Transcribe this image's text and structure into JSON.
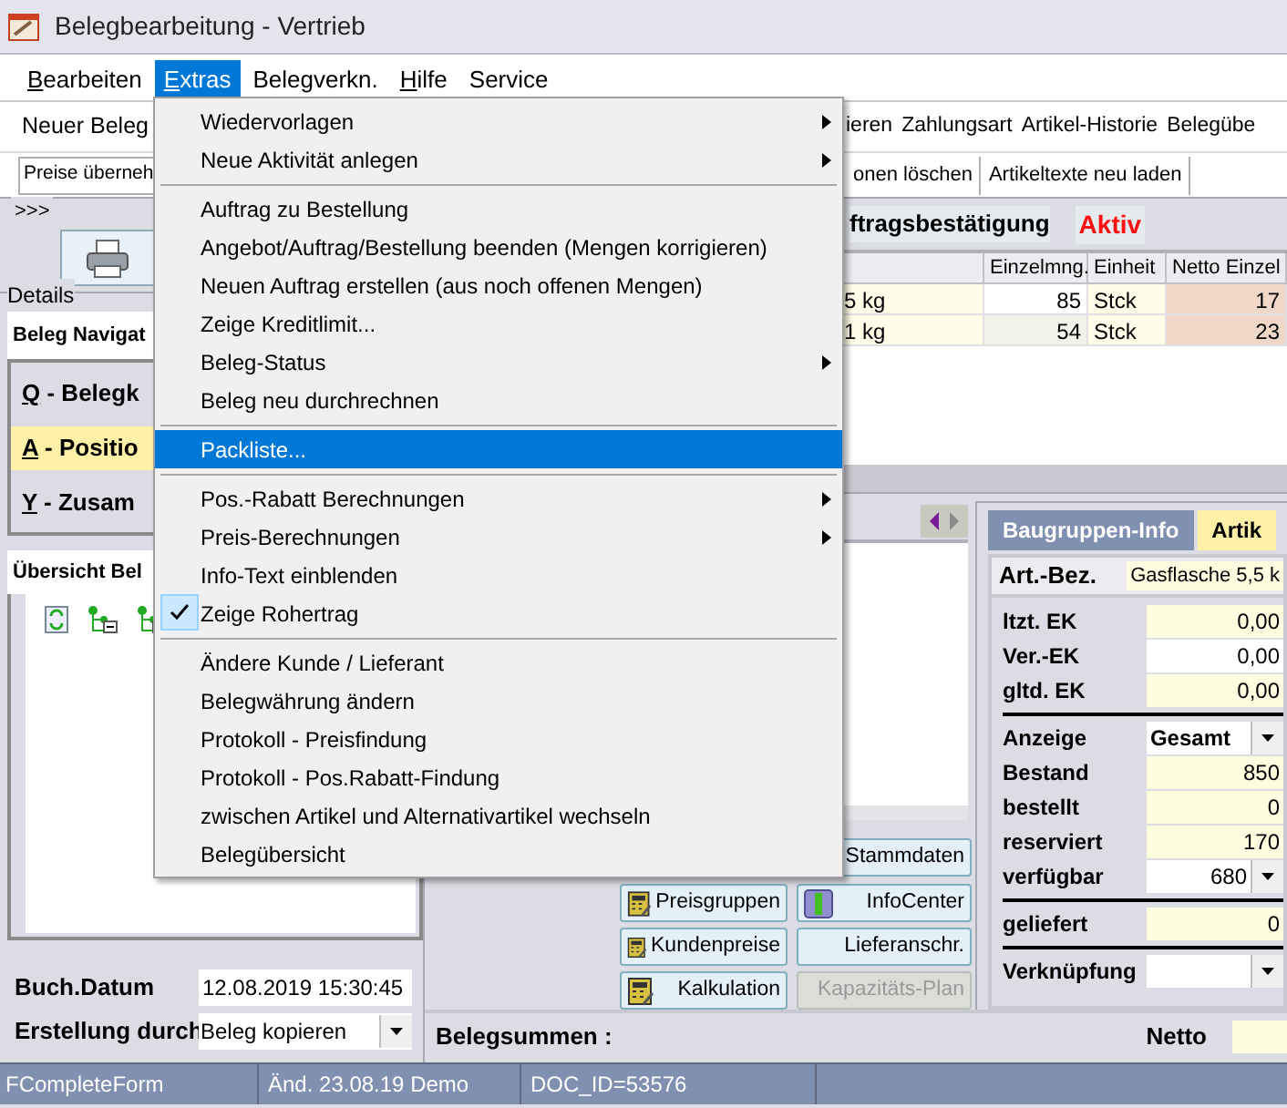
{
  "window": {
    "title": "Belegbearbeitung - Vertrieb"
  },
  "menu_bar": [
    {
      "label": "Bearbeiten",
      "selected": false
    },
    {
      "label": "Extras",
      "selected": true
    },
    {
      "label": "Belegverkn.",
      "selected": false
    },
    {
      "label": "Hilfe",
      "selected": false
    },
    {
      "label": "Service",
      "selected": false
    }
  ],
  "toolbar_1": {
    "left": "Neuer Beleg",
    "items": [
      "ieren",
      "Zahlungsart",
      "Artikel-Historie",
      "Belegübe"
    ]
  },
  "toolbar_2": {
    "left": "Preise überneh",
    "items": [
      "onen löschen",
      "Artikeltexte neu laden"
    ]
  },
  "expander": ">>>",
  "document": {
    "type": "ftragsbestätigung",
    "status": "Aktiv"
  },
  "table": {
    "columns": [
      "",
      "Einzelmng.",
      "Einheit",
      "Netto Einzel"
    ],
    "rows": [
      {
        "cells": [
          "5 kg",
          "85",
          "Stck",
          "17"
        ]
      },
      {
        "cells": [
          "1 kg",
          "54",
          "Stck",
          "23"
        ]
      }
    ]
  },
  "details": {
    "label": "Details",
    "navigator_tab": "Beleg Navigat",
    "nav_items": [
      {
        "label": "Q - Belegk",
        "selected": false
      },
      {
        "label": "A - Positio",
        "selected": true
      },
      {
        "label": "Y - Zusam",
        "selected": false
      }
    ],
    "overview_tab": "Übersicht Bel",
    "fields": [
      {
        "label": "Buch.Datum",
        "value": "12.08.2019 15:30:45",
        "kind": "text"
      },
      {
        "label": "Erstellung durch",
        "value": "Beleg kopieren",
        "kind": "dropdown"
      }
    ]
  },
  "buttons": [
    {
      "label": "Stammdaten",
      "disabled": false
    },
    {
      "label": "Preisgruppen",
      "disabled": false
    },
    {
      "label": "InfoCenter",
      "disabled": false
    },
    {
      "label": "Kundenpreise",
      "disabled": false
    },
    {
      "label": "Lieferanschr.",
      "disabled": false
    },
    {
      "label": "Kalkulation",
      "disabled": false
    },
    {
      "label": "Kapazitäts-Plan",
      "disabled": true
    }
  ],
  "info_tabs": [
    {
      "label": "Baugruppen-Info",
      "selected": false
    },
    {
      "label": "Artik",
      "selected": true
    }
  ],
  "article": {
    "label": "Art.-Bez.",
    "value": "Gasflasche 5,5 k"
  },
  "article_fields": [
    {
      "kind": "text",
      "label": "ltzt. EK",
      "value": "0,00",
      "highlighted": true
    },
    {
      "kind": "text",
      "label": "Ver.-EK",
      "value": "0,00",
      "highlighted": false
    },
    {
      "kind": "text",
      "label": "gltd. EK",
      "value": "0,00",
      "highlighted": true
    },
    {
      "kind": "separator"
    },
    {
      "kind": "dropdown",
      "label": "Anzeige",
      "value": "Gesamt",
      "highlighted": false
    },
    {
      "kind": "text",
      "label": "Bestand",
      "value": "850",
      "highlighted": true
    },
    {
      "kind": "text",
      "label": "bestellt",
      "value": "0",
      "highlighted": true
    },
    {
      "kind": "text",
      "label": "reserviert",
      "value": "170",
      "highlighted": true
    },
    {
      "kind": "dropdown",
      "label": "verfügbar",
      "value": "680",
      "highlighted": false
    },
    {
      "kind": "separator"
    },
    {
      "kind": "text",
      "label": "geliefert",
      "value": "0",
      "highlighted": true
    },
    {
      "kind": "separator"
    },
    {
      "kind": "dropdown",
      "label": "Verknüpfung",
      "highlighted": false
    }
  ],
  "summary": {
    "label": "Belegsummen :",
    "netto_label": "Netto"
  },
  "status_bar": [
    "FCompleteForm",
    "Änd. 23.08.19 Demo",
    "DOC_ID=53576"
  ],
  "menu": [
    {
      "kind": "item",
      "label": "Wiedervorlagen",
      "submenu": true,
      "selected": false,
      "checked": false
    },
    {
      "kind": "item",
      "label": "Neue Aktivität anlegen",
      "submenu": true,
      "selected": false,
      "checked": false
    },
    {
      "kind": "separator"
    },
    {
      "kind": "item",
      "label": "Auftrag zu Bestellung",
      "submenu": false,
      "selected": false,
      "checked": false
    },
    {
      "kind": "item",
      "label": "Angebot/Auftrag/Bestellung beenden (Mengen korrigieren)",
      "submenu": false,
      "selected": false,
      "checked": false
    },
    {
      "kind": "item",
      "label": "Neuen Auftrag erstellen (aus noch offenen Mengen)",
      "submenu": false,
      "selected": false,
      "checked": false
    },
    {
      "kind": "item",
      "label": "Zeige Kreditlimit...",
      "submenu": false,
      "selected": false,
      "checked": false
    },
    {
      "kind": "item",
      "label": "Beleg-Status",
      "submenu": true,
      "selected": false,
      "checked": false
    },
    {
      "kind": "item",
      "label": "Beleg neu durchrechnen",
      "submenu": false,
      "selected": false,
      "checked": false
    },
    {
      "kind": "separator"
    },
    {
      "kind": "item",
      "label": "Packliste...",
      "submenu": false,
      "selected": true,
      "checked": false
    },
    {
      "kind": "separator"
    },
    {
      "kind": "item",
      "label": "Pos.-Rabatt Berechnungen",
      "submenu": true,
      "selected": false,
      "checked": false
    },
    {
      "kind": "item",
      "label": "Preis-Berechnungen",
      "submenu": true,
      "selected": false,
      "checked": false
    },
    {
      "kind": "item",
      "label": "Info-Text einblenden",
      "submenu": false,
      "selected": false,
      "checked": false
    },
    {
      "kind": "item",
      "label": "Zeige Rohertrag",
      "submenu": false,
      "selected": false,
      "checked": true
    },
    {
      "kind": "separator"
    },
    {
      "kind": "item",
      "label": "Ändere Kunde / Lieferant",
      "submenu": false,
      "selected": false,
      "checked": false
    },
    {
      "kind": "item",
      "label": "Belegwährung ändern",
      "submenu": false,
      "selected": false,
      "checked": false
    },
    {
      "kind": "item",
      "label": "Protokoll - Preisfindung",
      "submenu": false,
      "selected": false,
      "checked": false
    },
    {
      "kind": "item",
      "label": "Protokoll - Pos.Rabatt-Findung",
      "submenu": false,
      "selected": false,
      "checked": false
    },
    {
      "kind": "item",
      "label": "zwischen Artikel und Alternativartikel wechseln",
      "submenu": false,
      "selected": false,
      "checked": false
    },
    {
      "kind": "item",
      "label": "Belegübersicht",
      "submenu": false,
      "selected": false,
      "checked": false
    }
  ]
}
